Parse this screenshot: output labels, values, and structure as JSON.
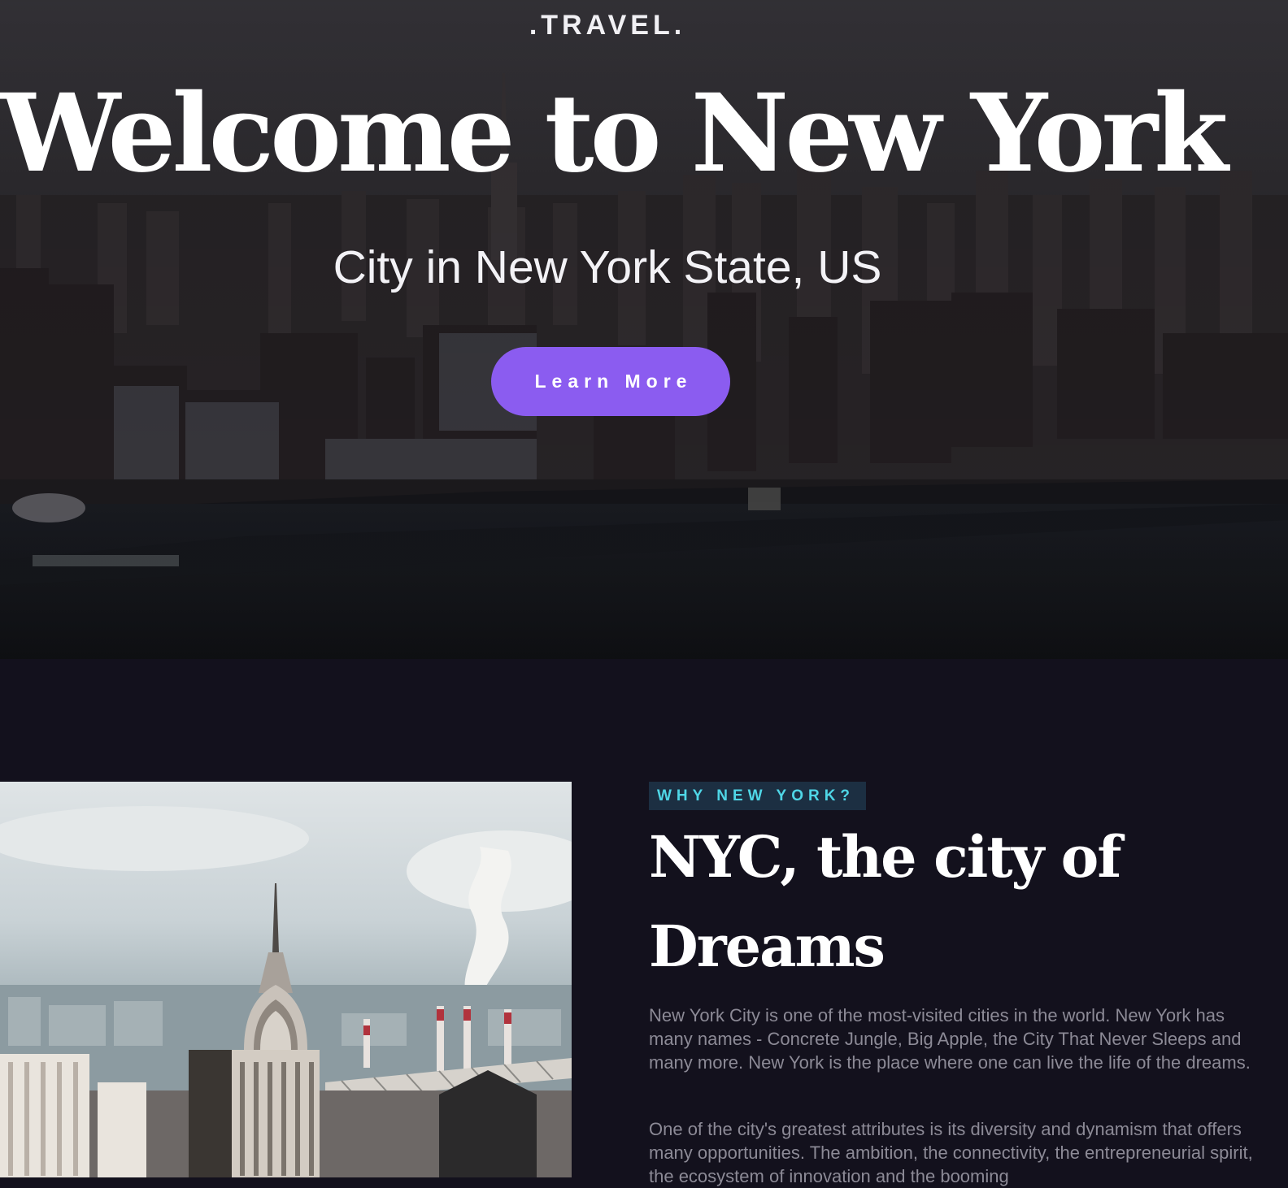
{
  "hero": {
    "brand": ".TRAVEL.",
    "title": "Welcome to New York",
    "subtitle": "City in New York State, US",
    "cta_label": "Learn More",
    "background_image": "aerial photo of the Manhattan skyline at dusk over the river"
  },
  "about": {
    "eyebrow": "WHY NEW YORK?",
    "title": "NYC, the city of Dreams",
    "paragraphs": [
      "New York City is one of the most-visited cities in the world. New York has many names - Concrete Jungle, Big Apple, the City That Never Sleeps and many more. New York is the place where one can live the life of the dreams.",
      "One of the city's greatest attributes is its diversity and dynamism that offers many opportunities. The ambition, the connectivity, the entrepreneurial spirit, the ecosystem of innovation and the booming"
    ],
    "image": "Chrysler Building spire with Queens skyline and smokestacks"
  },
  "colors": {
    "page_bg": "#13111d",
    "accent": "#8b5cf0",
    "eyebrow_text": "#4fd6e6",
    "eyebrow_bg": "#1c2f42",
    "body_text": "#8c8a96"
  }
}
